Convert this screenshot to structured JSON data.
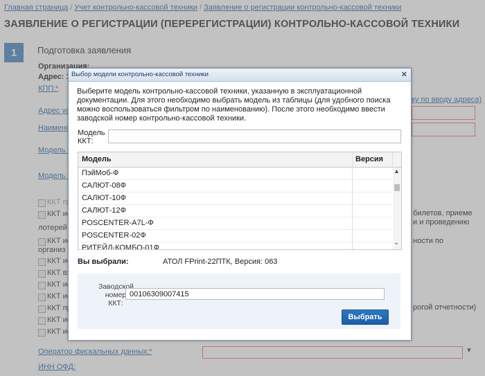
{
  "breadcrumb": {
    "items": [
      "Главная страница",
      "Учет контрольно-кассовой техники",
      "Заявление о регистрации контрольно-кассовой техники"
    ],
    "separator": "/"
  },
  "page": {
    "title": "ЗАЯВЛЕНИЕ О РЕГИСТРАЦИИ (ПЕРЕРЕГИСТРАЦИИ) КОНТРОЛЬНО-КАССОВОЙ ТЕХНИКИ",
    "step_number": "1",
    "step_title": "Подготовка заявления"
  },
  "background": {
    "org_label": "Организация:",
    "address_label": "Адрес: 1",
    "kpp_label": "КПП:",
    "required_mark": "*",
    "address_help_link": "ку по вводу адреса)",
    "address_field_label": "Адрес ус",
    "name_field_label": "Наимено",
    "model_kkt_label": "Модель К",
    "model_fn_label": "Модель Ф",
    "checkboxes": [
      "ККТ пр",
      "ККТ ис",
      "лотерей",
      "ККТ ис",
      "организ",
      "ККТ ис",
      "ККТ вх",
      "ККТ ис",
      "ККТ ис",
      "ККТ пр",
      "ККТ ис",
      "ККТ ис"
    ],
    "right_fragments": [
      "билетов, приеме",
      "и и проведению",
      "ности по",
      "рогой отчетности)"
    ],
    "fiscal_operator_label": "Оператор фискальных данных:",
    "inn_ofd_label": "ИНН ОФД:"
  },
  "modal": {
    "title": "Выбор модели контрольно-кассовой техники",
    "close_icon": "✕",
    "instruction": "Выберите модель контрольно-кассовой техники, указанную в эксплуатационной документации. Для этого необходимо выбрать модель из таблицы (для удобного поиска можно воспользоваться фильтром по наименованию). После этого необходимо ввести заводской номер контрольно-кассовой техники.",
    "filter_label": "Модель ККТ:",
    "table": {
      "columns": [
        "Модель",
        "Версия"
      ],
      "rows": [
        {
          "model": "ПэйМоб-Ф",
          "version": ""
        },
        {
          "model": "САЛЮТ-08Ф",
          "version": ""
        },
        {
          "model": "САЛЮТ-10Ф",
          "version": ""
        },
        {
          "model": "САЛЮТ-12Ф",
          "version": ""
        },
        {
          "model": "POSCENTER-A7L-Ф",
          "version": ""
        },
        {
          "model": "POSCENTER-02Ф",
          "version": ""
        },
        {
          "model": "РИТЕЙЛ-КОМБО-01Ф",
          "version": ""
        }
      ]
    },
    "selected_label": "Вы выбрали:",
    "selected_value": "АТОЛ FPrint-22ПТК, Версия: 063",
    "serial_label": "Заводской номер ККТ:",
    "serial_value": "00106309007415",
    "select_button": "Выбрать"
  },
  "colors": {
    "accent": "#4a86bf",
    "link": "#2f6aa6",
    "required": "#e23b3b",
    "button": "#1f66ae"
  }
}
